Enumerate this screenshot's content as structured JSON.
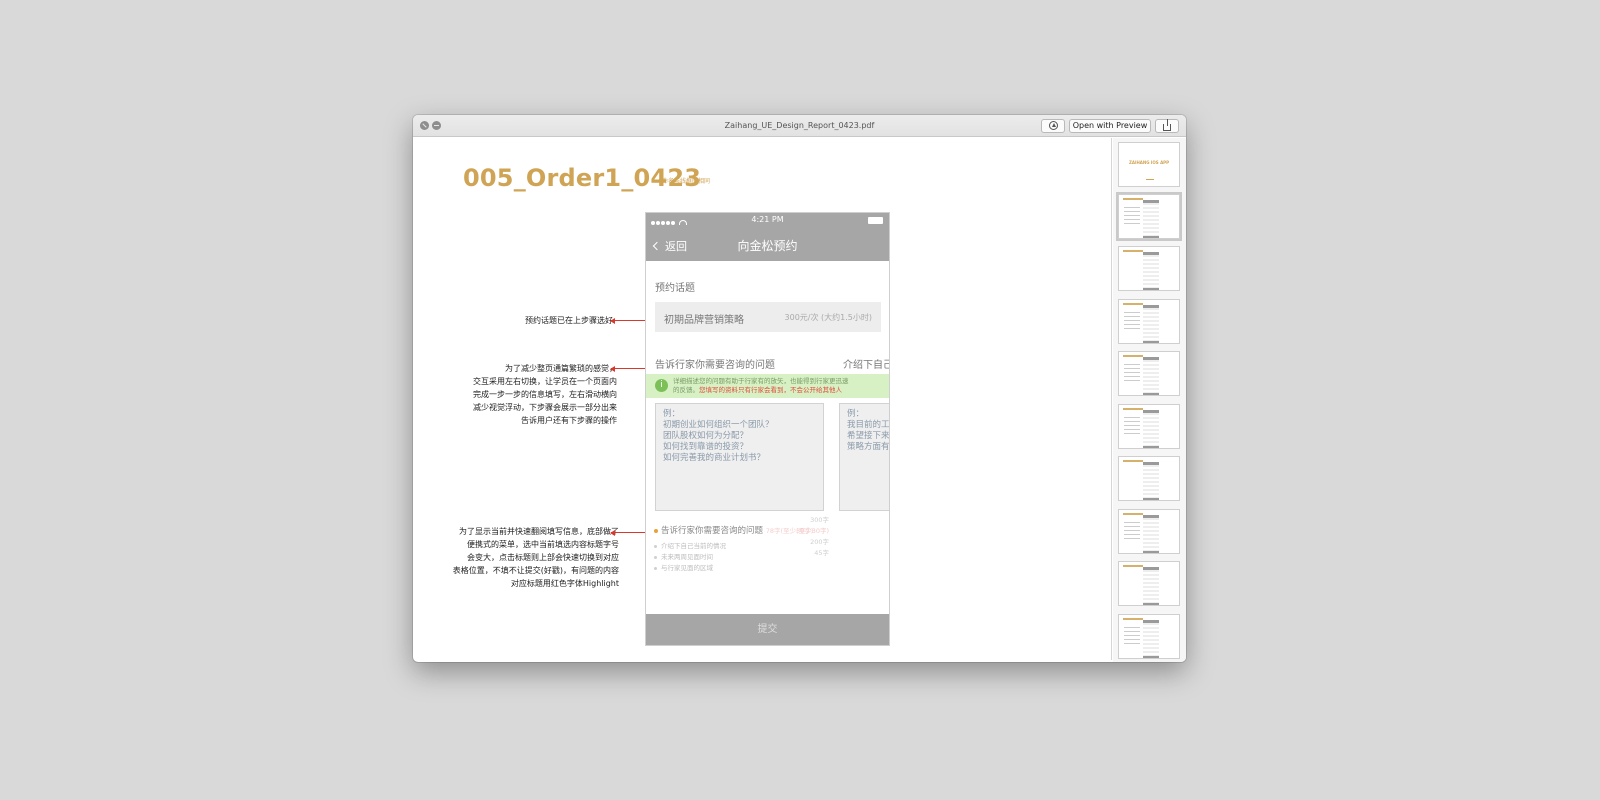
{
  "window": {
    "title": "Zaihang_UE_Design_Report_0423.pdf",
    "open_with_preview_label": "Open with Preview",
    "markup_icon": "markup-icon",
    "share_icon": "share-icon"
  },
  "page": {
    "title": "005_Order1_0423",
    "title_note": "*命名与线框图相同"
  },
  "phone": {
    "status_time": "4:21 PM",
    "back_label": "返回",
    "nav_title": "向金松预约",
    "section_label": "预约话题",
    "topic_name": "初期品牌营销策略",
    "topic_price": "300元/次 (大约1.5小时)",
    "question_title": "告诉行家你需要咨询的问题",
    "next_question_title": "介绍下自己",
    "tip_line1": "详细描述您的问题有助于行家有的放矢，也能得到行家更迅速",
    "tip_line2_prefix": "的反馈。",
    "tip_line2_red": "您填写的资料只有行家会看到，不会公开给其他人",
    "textarea1": "例：\n初期创业如何组织一个团队？\n团队股权如何为分配？\n如何找到靠谱的投资？\n如何完善我的商业计划书？",
    "textarea2": "例：\n我目前的工\n希望接下来\n策略方面有",
    "counters": [
      "300字",
      "(至少30字)",
      "200字",
      "45字"
    ],
    "steps": {
      "active_label": "告诉行家你需要咨询的问题",
      "active_hint": "78字(至少30字)",
      "items": [
        "介绍下自己当前的情况",
        "未来两周见面时间",
        "与行家见面的区域"
      ]
    },
    "submit_label": "提交"
  },
  "annotations": {
    "note1": "预约话题已在上步骤选好",
    "note2": [
      "为了减少整页通篇繁琐的感觉，",
      "交互采用左右切换，让学员在一个页面内",
      "完成一步一步的信息填写，左右滑动横向",
      "减少视觉浮动，下步骤会展示一部分出来",
      "告诉用户还有下步骤的操作"
    ],
    "note3": [
      "为了显示当前并快速翻阅填写信息，底部做了",
      "便携式的菜单，选中当前填选内容标题字号",
      "会变大，点击标题则上部会快速切换到对应",
      "表格位置，不填不让提交(好戳)，有问题的内容",
      "对应标题用红色字体Highlight"
    ]
  },
  "sidebar": {
    "cover_text": "ZAIHANG IOS APP",
    "selected_index": 1
  },
  "colors": {
    "desktop": "#d9d9d9",
    "title_gold": "#d0a455",
    "phone_bar": "#a6a6a6",
    "tip_green": "#d7f1c5",
    "highlight_red": "#d9382c"
  }
}
